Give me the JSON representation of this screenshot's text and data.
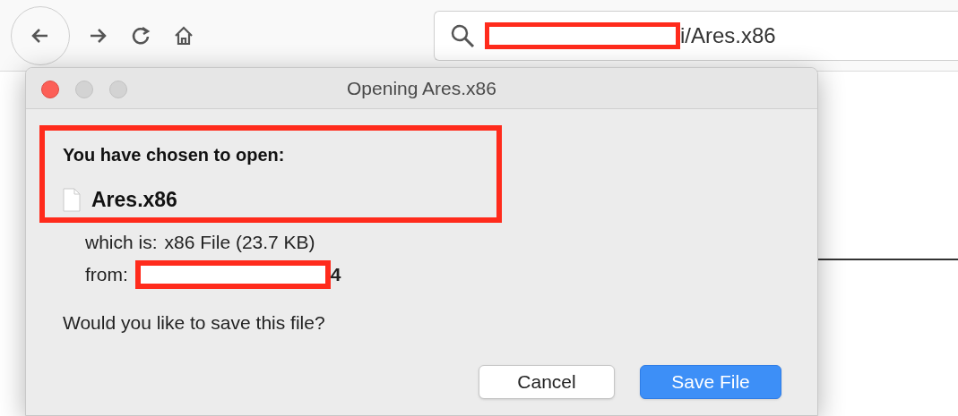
{
  "toolbar": {
    "buttons": [
      {
        "kind": "back",
        "circled": true
      },
      {
        "kind": "forward",
        "circled": false
      },
      {
        "kind": "reload",
        "circled": false
      },
      {
        "kind": "home",
        "circled": false
      }
    ]
  },
  "address_bar": {
    "text": "i/Ares.x86"
  },
  "dialog": {
    "title": "Opening Ares.x86",
    "heading": "You have chosen to open:",
    "file_name": "Ares.x86",
    "details": [
      {
        "label": "which is:",
        "value": "x86 File (23.7 KB)",
        "redacted": false,
        "bold": false
      },
      {
        "label": "from:",
        "value": "4",
        "redacted": true,
        "bold": true
      }
    ],
    "question": "Would you like to save this file?",
    "buttons": [
      {
        "label": "Cancel",
        "kind": "default"
      },
      {
        "label": "Save File",
        "kind": "primary"
      }
    ]
  }
}
